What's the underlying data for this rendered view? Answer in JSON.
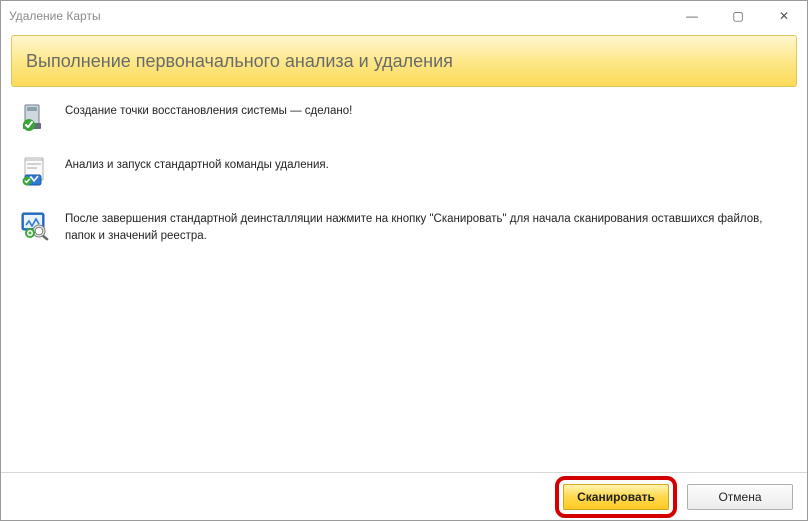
{
  "window": {
    "title": "Удаление Карты"
  },
  "header": {
    "title": "Выполнение первоначального анализа и удаления"
  },
  "steps": [
    {
      "text": "Создание точки восстановления системы — сделано!"
    },
    {
      "text": "Анализ и запуск стандартной команды удаления."
    },
    {
      "text": "После завершения стандартной деинсталляции нажмите на кнопку \"Сканировать\" для начала сканирования оставшихся файлов, папок и значений реестра."
    }
  ],
  "footer": {
    "scan_label": "Сканировать",
    "cancel_label": "Отмена"
  },
  "icons": {
    "minimize": "—",
    "maximize": "▢",
    "close": "✕"
  }
}
